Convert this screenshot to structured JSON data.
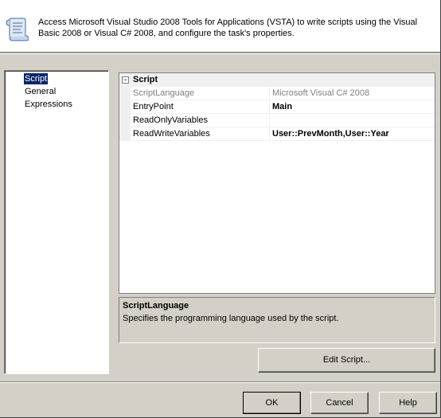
{
  "header": {
    "description": "Access Microsoft Visual Studio 2008 Tools for Applications (VSTA) to write scripts using the Visual Basic 2008 or Visual C# 2008, and configure the task's properties.",
    "icon": "script-scroll-icon"
  },
  "nav": {
    "items": [
      {
        "label": "Script",
        "selected": true
      },
      {
        "label": "General",
        "selected": false
      },
      {
        "label": "Expressions",
        "selected": false
      }
    ]
  },
  "grid": {
    "category": {
      "label": "Script",
      "toggle": "⊟"
    },
    "properties": [
      {
        "name": "ScriptLanguage",
        "value": "Microsoft Visual C# 2008",
        "readonly": true
      },
      {
        "name": "EntryPoint",
        "value": "Main",
        "readonly": false
      },
      {
        "name": "ReadOnlyVariables",
        "value": "",
        "readonly": false
      },
      {
        "name": "ReadWriteVariables",
        "value": "User::PrevMonth,User::Year",
        "readonly": false
      }
    ]
  },
  "description_panel": {
    "title": "ScriptLanguage",
    "text": "Specifies the programming language used by the script."
  },
  "buttons": {
    "edit_script": "Edit Script...",
    "ok": "OK",
    "cancel": "Cancel",
    "help": "Help"
  },
  "colors": {
    "selection": "#0a246a",
    "face": "#d4d0c8",
    "grid_gutter": "#f0f0f0"
  }
}
